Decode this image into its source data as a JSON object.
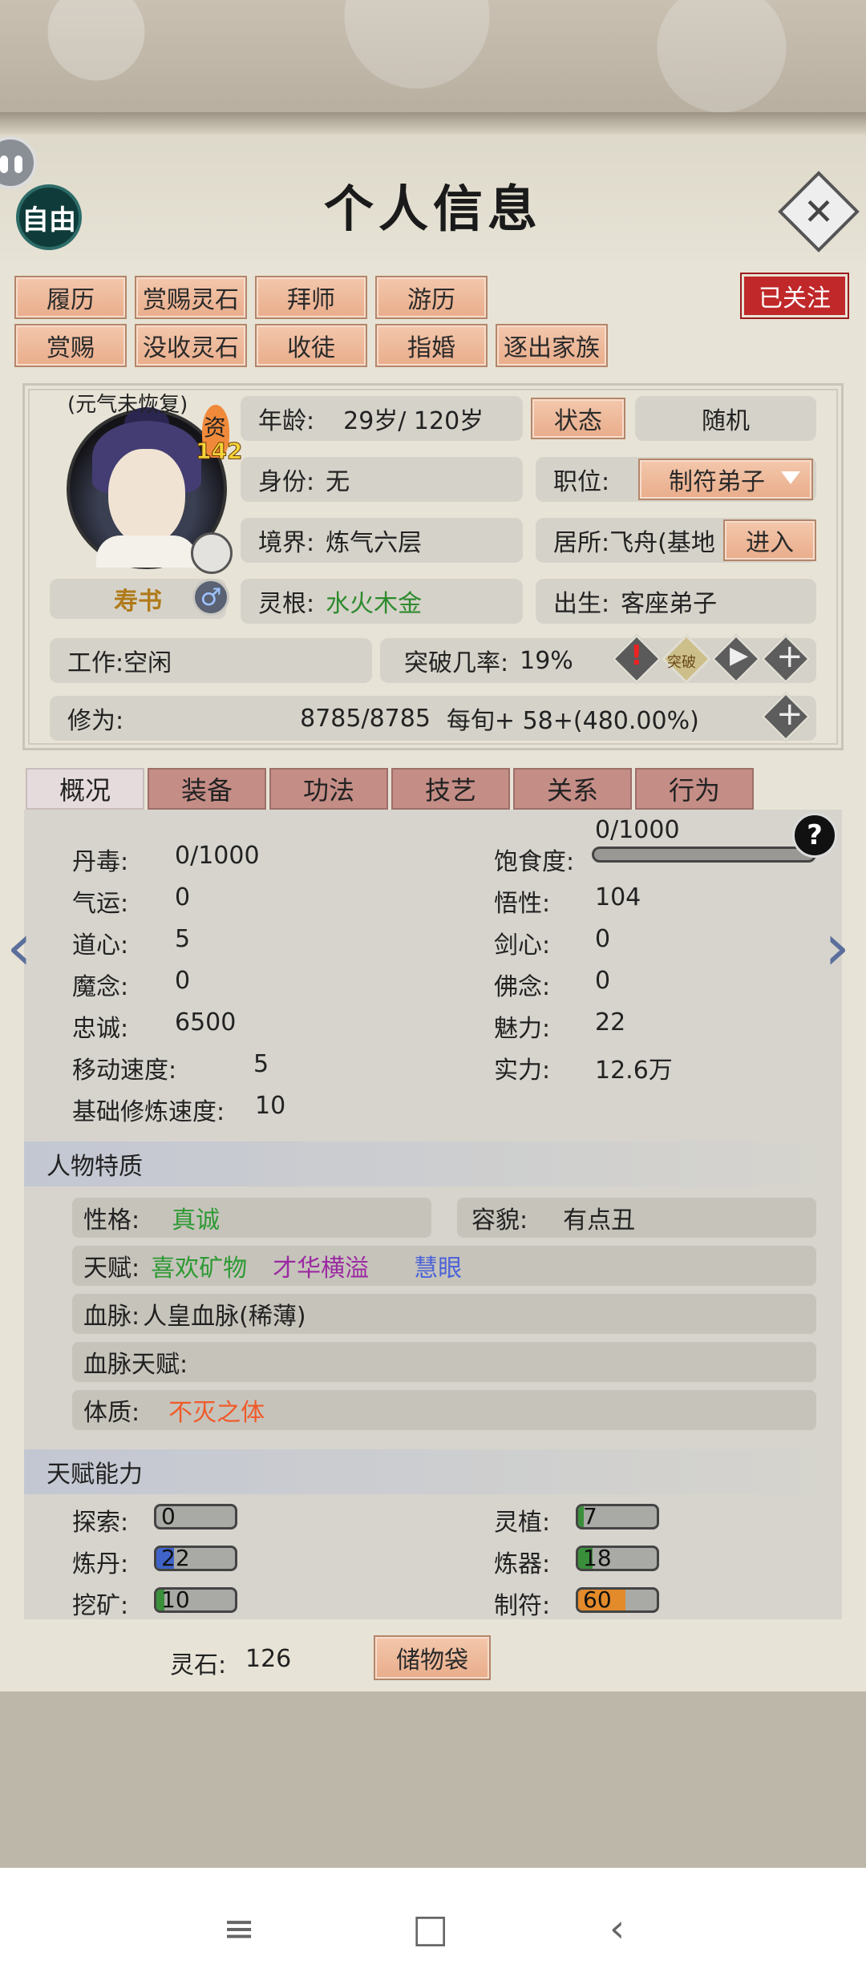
{
  "header": {
    "title": "个人信息",
    "free_mode": "自由",
    "close_glyph": "✕"
  },
  "actions": {
    "row1": [
      "履历",
      "赏赐灵石",
      "拜师",
      "游历"
    ],
    "row2": [
      "赏赐",
      "没收灵石",
      "收徒",
      "指婚",
      "逐出家族"
    ],
    "follow": "已关注"
  },
  "profile": {
    "status_note": "(元气未恢复)",
    "zi": "资",
    "zi_value": "142",
    "lifebook": "寿书",
    "gender_icon": "male-icon",
    "age_label": "年龄:",
    "age_value": "29岁/ 120岁",
    "status_btn": "状态",
    "random_btn": "随机",
    "identity_label": "身份:",
    "identity_value": "无",
    "position_label": "职位:",
    "position_value": "制符弟子",
    "realm_label": "境界:",
    "realm_value": "炼气六层",
    "residence_label": "居所:",
    "residence_value": "飞舟(基地",
    "enter_btn": "进入",
    "root_label": "灵根:",
    "root_value": "水火木金",
    "birth_label": "出生:",
    "birth_value": "客座弟子",
    "work_label": "工作:",
    "work_value": "空闲",
    "breakthrough_label": "突破几率:",
    "breakthrough_value": "19%",
    "breakthrough_badge": "突破",
    "cultivation_label": "修为:",
    "cultivation_value": "8785/8785",
    "per_turn": "每旬+  58+(480.00%)"
  },
  "tabs": [
    "概况",
    "装备",
    "功法",
    "技艺",
    "关系",
    "行为"
  ],
  "overview": {
    "left": [
      {
        "label": "丹毒:",
        "value": "0/1000"
      },
      {
        "label": "气运:",
        "value": "0"
      },
      {
        "label": "道心:",
        "value": "5"
      },
      {
        "label": "魔念:",
        "value": "0"
      },
      {
        "label": "忠诚:",
        "value": "6500"
      },
      {
        "label": "移动速度:",
        "value": "5"
      },
      {
        "label": "基础修炼速度:",
        "value": "10"
      }
    ],
    "right": [
      {
        "label": "饱食度:",
        "value": ""
      },
      {
        "label": "悟性:",
        "value": "104"
      },
      {
        "label": "剑心:",
        "value": "0"
      },
      {
        "label": "佛念:",
        "value": "0"
      },
      {
        "label": "魅力:",
        "value": "22"
      },
      {
        "label": "实力:",
        "value": "12.6万"
      }
    ],
    "satiety_value": "0/1000",
    "satiety_fraction": 0,
    "help": "?"
  },
  "traits": {
    "title": "人物特质",
    "personality_label": "性格:",
    "personality_value": "真诚",
    "looks_label": "容貌:",
    "looks_value": "有点丑",
    "talent_label": "天赋:",
    "talents": [
      "喜欢矿物",
      "才华横溢",
      "慧眼"
    ],
    "talent_colors": [
      "#2e9a34",
      "#9b2aa2",
      "#4c63d8"
    ],
    "bloodline_label": "血脉:",
    "bloodline_value": "人皇血脉(稀薄)",
    "bloodline_talent_label": "血脉天赋:",
    "body_label": "体质:",
    "body_value": "不灭之体",
    "body_color": "#f05a2a"
  },
  "abilities": {
    "title": "天赋能力",
    "items": [
      {
        "label": "探索:",
        "value": "0",
        "fill": 0,
        "color": "#7a7a7a"
      },
      {
        "label": "灵植:",
        "value": "7",
        "fill": 0.07,
        "color": "#3a8f3a"
      },
      {
        "label": "炼丹:",
        "value": "22",
        "fill": 0.22,
        "color": "#3f63c9"
      },
      {
        "label": "炼器:",
        "value": "18",
        "fill": 0.18,
        "color": "#3a8f3a"
      },
      {
        "label": "挖矿:",
        "value": "10",
        "fill": 0.1,
        "color": "#3a8f3a"
      },
      {
        "label": "制符:",
        "value": "60",
        "fill": 0.6,
        "color": "#e38a2a"
      }
    ]
  },
  "footer": {
    "spirit_stone_label": "灵石:",
    "spirit_stone_value": "126",
    "bag_btn": "储物袋"
  },
  "navbar": {
    "menu": "≡",
    "home": "□",
    "back": "‹"
  }
}
